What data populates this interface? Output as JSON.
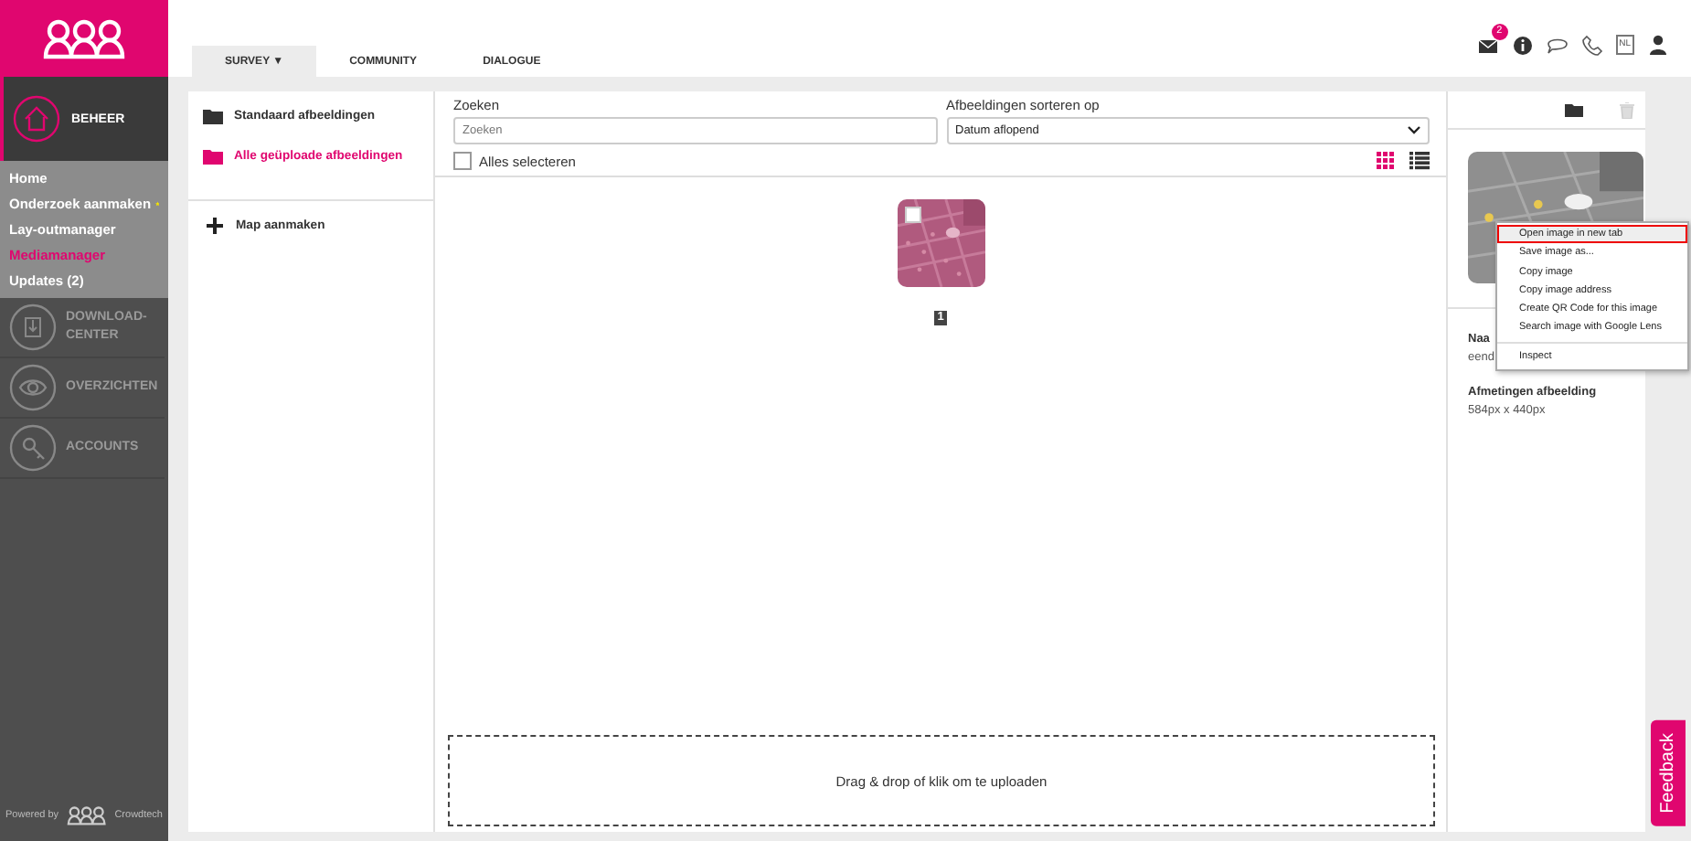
{
  "sidebar": {
    "section": {
      "label": "BEHEER",
      "selected": true
    },
    "items": [
      {
        "label": "Home",
        "selected": false,
        "starred": false
      },
      {
        "label": "Onderzoek aanmaken",
        "selected": false,
        "starred": true
      },
      {
        "label": "Lay-outmanager",
        "selected": false,
        "starred": false
      },
      {
        "label": "Mediamanager",
        "selected": true,
        "starred": false
      },
      {
        "label": "Updates (2)",
        "selected": false,
        "starred": false
      }
    ],
    "sections": [
      {
        "kind": "download",
        "label": "DOWNLOAD-CENTER"
      },
      {
        "kind": "eye",
        "label": "OVERZICHTEN"
      },
      {
        "kind": "key",
        "label": "ACCOUNTS"
      }
    ],
    "footer": {
      "powered_by": "Powered by",
      "brand": "Crowdtech"
    }
  },
  "tabs": [
    {
      "label": "SURVEY ▼",
      "selected": true
    },
    {
      "label": "COMMUNITY",
      "selected": false
    },
    {
      "label": "DIALOGUE",
      "selected": false
    }
  ],
  "header_icons": [
    {
      "kind": "mail",
      "badge": "2"
    },
    {
      "kind": "info"
    },
    {
      "kind": "chat"
    },
    {
      "kind": "phone"
    },
    {
      "kind": "language",
      "label": "NL"
    },
    {
      "kind": "user"
    }
  ],
  "folders": [
    {
      "label": "Standaard afbeeldingen",
      "selected": false
    },
    {
      "label": "Alle geüploade afbeeldingen",
      "selected": true
    }
  ],
  "create_folder": "Map aanmaken",
  "search": {
    "label": "Zoeken",
    "placeholder": "Zoeken"
  },
  "sort": {
    "label": "Afbeeldingen sorteren op",
    "value": "Datum aflopend"
  },
  "select_all": {
    "label": "Alles selecteren",
    "checked": false
  },
  "view_modes": [
    {
      "kind": "grid",
      "selected": true
    },
    {
      "kind": "list",
      "selected": false
    }
  ],
  "pagination": [
    {
      "label": "1",
      "selected": true
    }
  ],
  "upload": "Drag & drop of klik om te uploaden",
  "details": {
    "fields": [
      {
        "label": "Naa",
        "value": "eend"
      },
      {
        "label": "Afmetingen afbeelding",
        "value": "584px x 440px"
      }
    ]
  },
  "context_menu": {
    "items": [
      {
        "label": "Open image in new tab",
        "selected": true,
        "divider_before": false
      },
      {
        "label": "Save image as...",
        "selected": false,
        "divider_before": false
      },
      {
        "label": "Copy image",
        "selected": false,
        "divider_before": false
      },
      {
        "label": "Copy image address",
        "selected": false,
        "divider_before": false
      },
      {
        "label": "Create QR Code for this image",
        "selected": false,
        "divider_before": false
      },
      {
        "label": "Search image with Google Lens",
        "selected": false,
        "divider_before": false
      },
      {
        "label": "Inspect",
        "selected": false,
        "divider_before": true
      }
    ]
  },
  "feedback": "Feedback"
}
